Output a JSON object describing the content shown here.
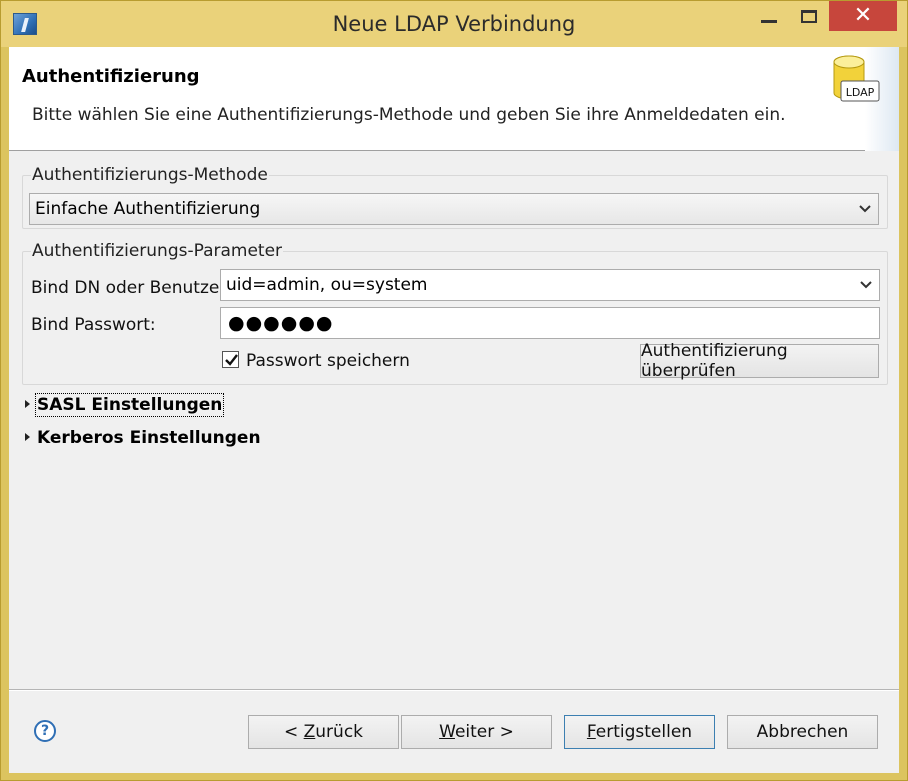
{
  "window": {
    "title": "Neue LDAP Verbindung",
    "minimize_icon": "minimize-icon",
    "maximize_icon": "maximize-icon",
    "close_icon": "close-icon",
    "close_color": "#c7463c"
  },
  "banner": {
    "title": "Authentifizierung",
    "description": "Bitte wählen Sie eine Authentifizierungs-Methode und geben Sie ihre Anmeldedaten ein.",
    "icon_label": "LDAP"
  },
  "method_group": {
    "label": "Authentifizierungs-Methode",
    "selected": "Einfache Authentifizierung"
  },
  "params_group": {
    "label": "Authentifizierungs-Parameter",
    "bind_dn_label": "Bind DN oder Benutzer:",
    "bind_dn_value": "uid=admin, ou=system",
    "password_label": "Bind Passwort:",
    "password_mask": "●●●●●●",
    "save_password_label": "Passwort speichern",
    "save_password_checked": true,
    "check_auth_button": "Authentifizierung überprüfen"
  },
  "sections": {
    "sasl": "SASL Einstellungen",
    "kerberos": "Kerberos Einstellungen"
  },
  "footer": {
    "help_icon": "help-icon",
    "back_prefix": "< ",
    "back_mnemonic": "Z",
    "back_rest": "urück",
    "next_mnemonic": "W",
    "next_rest": "eiter >",
    "finish_mnemonic": "F",
    "finish_rest": "ertigstellen",
    "cancel": "Abbrechen"
  }
}
